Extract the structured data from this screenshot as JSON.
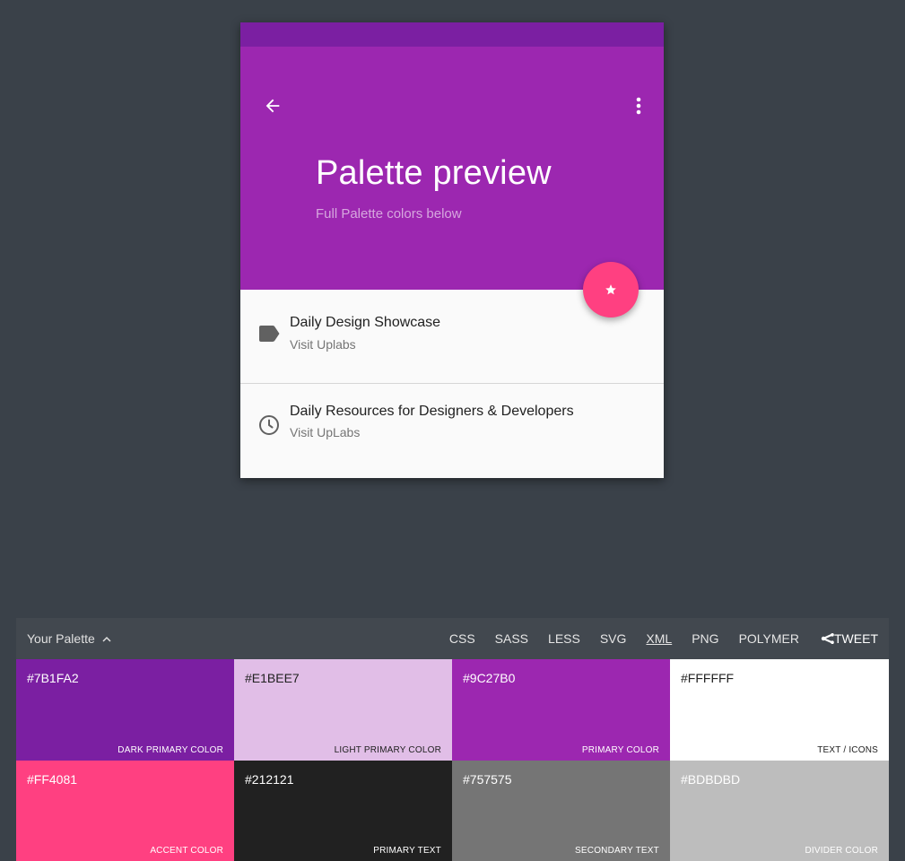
{
  "preview": {
    "title": "Palette preview",
    "subtitle": "Full Palette colors below",
    "icons": {
      "back": "arrow-left-icon",
      "more": "more-vert-icon",
      "fab": "star-icon",
      "item1": "label-icon",
      "item2": "clock-icon"
    },
    "items": [
      {
        "title": "Daily Design Showcase",
        "subtitle": "Visit Uplabs"
      },
      {
        "title": "Daily Resources for Designers & Developers",
        "subtitle": "Visit UpLabs"
      }
    ]
  },
  "palette": {
    "toggle_label": "Your Palette",
    "toggle_icon": "chevron-up-icon",
    "exports": [
      "CSS",
      "SASS",
      "LESS",
      "SVG",
      "XML",
      "PNG",
      "POLYMER"
    ],
    "active_export": "XML",
    "tweet_label": "TWEET",
    "tweet_icon": "share-icon",
    "swatches": [
      {
        "hex": "#7B1FA2",
        "label": "DARK PRIMARY COLOR",
        "bg": "#7B1FA2",
        "fg": "#ffffff"
      },
      {
        "hex": "#E1BEE7",
        "label": "LIGHT PRIMARY COLOR",
        "bg": "#E1BEE7",
        "fg": "#212121"
      },
      {
        "hex": "#9C27B0",
        "label": "PRIMARY COLOR",
        "bg": "#9C27B0",
        "fg": "#ffffff"
      },
      {
        "hex": "#FFFFFF",
        "label": "TEXT / ICONS",
        "bg": "#FFFFFF",
        "fg": "#212121"
      },
      {
        "hex": "#FF4081",
        "label": "ACCENT COLOR",
        "bg": "#FF4081",
        "fg": "#ffffff"
      },
      {
        "hex": "#212121",
        "label": "PRIMARY TEXT",
        "bg": "#212121",
        "fg": "#ffffff"
      },
      {
        "hex": "#757575",
        "label": "SECONDARY TEXT",
        "bg": "#757575",
        "fg": "#ffffff"
      },
      {
        "hex": "#BDBDBD",
        "label": "DIVIDER COLOR",
        "bg": "#BDBDBD",
        "fg": "#ffffff"
      }
    ]
  },
  "colors": {
    "background": "#3a4149",
    "dark_primary": "#7B1FA2",
    "primary": "#9C27B0",
    "accent": "#FF4081",
    "light_primary": "#E1BEE7"
  }
}
